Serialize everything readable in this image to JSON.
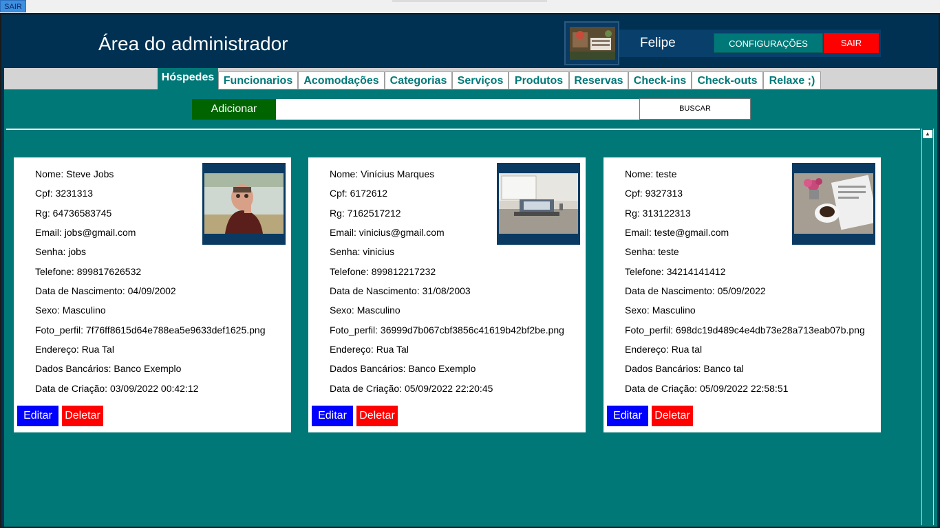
{
  "top_sair_label": "SAIR",
  "header": {
    "title": "Área do administrador",
    "user_name": "Felipe",
    "config_label": "CONFIGURAÇÕES",
    "sair_label": "SAIR"
  },
  "tabs": [
    {
      "label": "Hóspedes",
      "active": true
    },
    {
      "label": "Funcionarios"
    },
    {
      "label": "Acomodações"
    },
    {
      "label": "Categorias"
    },
    {
      "label": "Serviços"
    },
    {
      "label": "Produtos"
    },
    {
      "label": "Reservas"
    },
    {
      "label": "Check-ins"
    },
    {
      "label": "Check-outs"
    },
    {
      "label": "Relaxe ;)"
    }
  ],
  "toolbar": {
    "add_label": "Adicionar",
    "search_value": "",
    "search_button": "BUSCAR"
  },
  "cards": [
    {
      "lines": [
        "Nome: Steve Jobs",
        "Cpf: 3231313",
        "Rg: 64736583745",
        "Email: jobs@gmail.com",
        "Senha: jobs",
        "Telefone: 899817626532",
        "Data de Nascimento: 04/09/2002",
        "Sexo: Masculino",
        "Foto_perfil: 7f76ff8615d64e788ea5e9633def1625.png",
        "Endereço: Rua Tal",
        "Dados Bancários: Banco Exemplo",
        "Data de Criação: 03/09/2022 00:42:12"
      ],
      "edit_label": "Editar",
      "delete_label": "Deletar"
    },
    {
      "lines": [
        "Nome: Vinícius Marques",
        "Cpf: 6172612",
        "Rg: 7162517212",
        "Email: vinicius@gmail.com",
        "Senha: vinicius",
        "Telefone: 899812217232",
        "Data de Nascimento: 31/08/2003",
        "Sexo: Masculino",
        "Foto_perfil: 36999d7b067cbf3856c41619b42bf2be.png",
        "Endereço: Rua Tal",
        "Dados Bancários: Banco Exemplo",
        "Data de Criação: 05/09/2022 22:20:45"
      ],
      "edit_label": "Editar",
      "delete_label": "Deletar"
    },
    {
      "lines": [
        "Nome: teste",
        "Cpf: 9327313",
        "Rg: 313122313",
        "Email: teste@gmail.com",
        "Senha: teste",
        "Telefone: 34214141412",
        "Data de Nascimento: 05/09/2022",
        "Sexo: Masculino",
        "Foto_perfil: 698dc19d489c4e4db73e28a713eab07b.png",
        "Endereço: Rua tal",
        "Dados Bancários:  Banco tal",
        "Data de Criação: 05/09/2022 22:58:51"
      ],
      "edit_label": "Editar",
      "delete_label": "Deletar"
    }
  ],
  "colors": {
    "header_bg": "#003152",
    "content_bg": "#007878",
    "tab_text": "#007878",
    "add_button": "#006400",
    "edit_button": "#0000ff",
    "delete_button": "#ff0000"
  }
}
